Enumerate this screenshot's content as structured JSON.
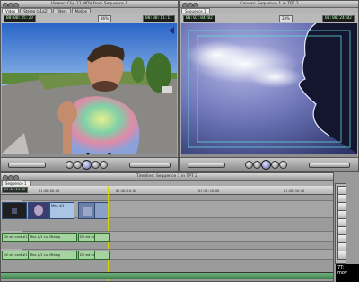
{
  "viewer": {
    "title": "Viewer: Clip 12.MOV from Sequence 1",
    "tabs": [
      "Video",
      "Stereo (a1a2)",
      "Filters",
      "Motion"
    ],
    "active_tab": 0,
    "duration_tc": "00:00:35:29",
    "current_tc": "00:00:11:11",
    "zoom": "36%"
  },
  "canvas": {
    "title": "Canvas: Sequence 1 in TPT 2",
    "tabs": [
      "Sequence 1"
    ],
    "active_tab": 0,
    "duration_tc": "00:02:04:02",
    "current_tc": "01:00:24:02",
    "zoom": "33%"
  },
  "timeline": {
    "title": "Timeline: Sequence 1 in TPT 2",
    "tabs": [
      "Sequence 1"
    ],
    "active_tab": 0,
    "current_tc": "01:00:24:02",
    "ruler_labels": [
      "01:00:00:00",
      "01:00:10:00",
      "01:00:20:00",
      "01:00:30:00"
    ],
    "tracks": {
      "v1_clips": [
        "Misc 4/1",
        ""
      ],
      "a1_clips": [
        "DV vid cont #1",
        "Misc A/1 cut Mixing",
        "DV vid cont #1",
        ""
      ],
      "a2_clips": [
        "DV vid cont #1",
        "Misc A/1 cut Mixing",
        "DV vid cont #1",
        ""
      ]
    }
  },
  "overlay_text": [
    "7T:",
    "mov"
  ],
  "colors": {
    "video_clip": "#a9c4e4",
    "audio_clip": "#a6d4a0",
    "timecode_text": "#b7ffb7",
    "playhead": "#d4d400"
  }
}
